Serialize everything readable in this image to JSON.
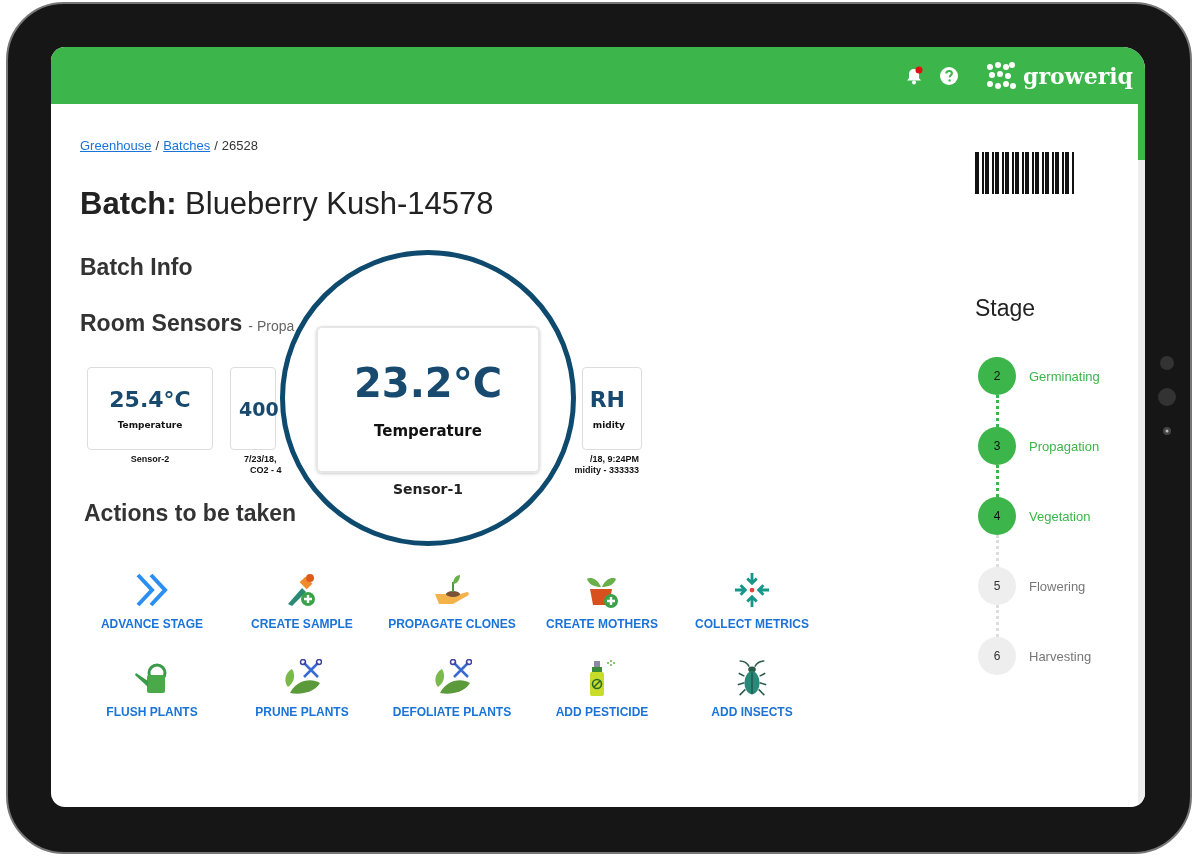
{
  "header": {
    "logo": "groweriq",
    "notification_unread": true
  },
  "breadcrumb": {
    "separator": "/",
    "items": [
      {
        "label": "Greenhouse",
        "link": true
      },
      {
        "label": "Batches",
        "link": true
      },
      {
        "label": "26528",
        "link": false
      }
    ]
  },
  "title": {
    "prefix": "Batch:",
    "name": "Blueberry Kush-14578"
  },
  "batch_info": "Batch Info",
  "sensors": {
    "heading": "Room Sensors",
    "subtitle": "- Propa",
    "cards": [
      {
        "value": "25.4°C",
        "label": "Temperature",
        "caption": [
          "Sensor-2"
        ]
      },
      {
        "value": "400",
        "caption": [
          "7/23/18,",
          "CO2 - 4"
        ]
      },
      {
        "value": "RH",
        "label": "midity",
        "caption": [
          "/18, 9:24PM",
          "midity - 333333"
        ]
      }
    ]
  },
  "magnifier": {
    "value": "23.2°C",
    "label": "Temperature",
    "sensor": "Sensor-1"
  },
  "actions": {
    "heading": "Actions to be taken",
    "items": [
      {
        "label": "ADVANCE STAGE",
        "kind": "advance"
      },
      {
        "label": "CREATE SAMPLE",
        "kind": "sample"
      },
      {
        "label": "PROPAGATE CLONES",
        "kind": "clones"
      },
      {
        "label": "CREATE MOTHERS",
        "kind": "mothers"
      },
      {
        "label": "COLLECT METRICS",
        "kind": "metrics"
      },
      {
        "label": "FLUSH PLANTS",
        "kind": "flush"
      },
      {
        "label": "PRUNE PLANTS",
        "kind": "prune"
      },
      {
        "label": "DEFOLIATE PLANTS",
        "kind": "prune"
      },
      {
        "label": "ADD PESTICIDE",
        "kind": "pesticide"
      },
      {
        "label": "ADD INSECTS",
        "kind": "insects"
      }
    ]
  },
  "stage": {
    "heading": "Stage",
    "steps": [
      {
        "number": "2",
        "label": "Germinating",
        "done": true
      },
      {
        "number": "3",
        "label": "Propagation",
        "done": true
      },
      {
        "number": "4",
        "label": "Vegetation",
        "done": true
      },
      {
        "number": "5",
        "label": "Flowering",
        "done": false
      },
      {
        "number": "6",
        "label": "Harvesting",
        "done": false
      }
    ]
  }
}
